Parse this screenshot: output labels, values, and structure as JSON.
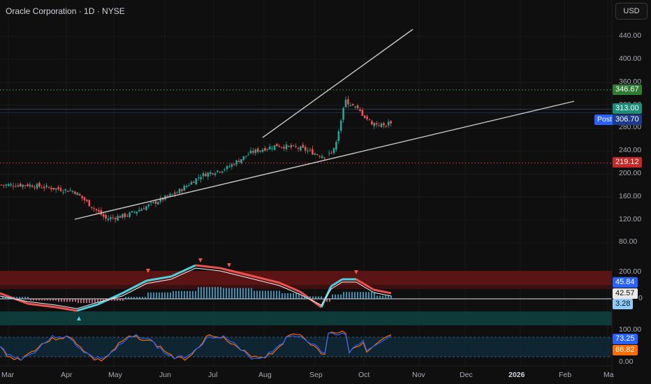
{
  "header": {
    "title": "Oracle Corporation · 1D · NYSE",
    "currency_button": "USD"
  },
  "price_axis": {
    "ticks": [
      "440.00",
      "400.00",
      "360.00",
      "320.00",
      "280.00",
      "240.00",
      "200.00",
      "160.00",
      "120.00",
      "80.00"
    ]
  },
  "price_labels": {
    "resistance": "346.67",
    "last": "313.00",
    "post_tag": "Post",
    "post": "306.70",
    "support": "219.12"
  },
  "oscillator_axis": {
    "top": "200.00",
    "value_a": "45.84",
    "value_b": "42.57",
    "zero": "0",
    "value_c": "3.28"
  },
  "stoch_axis": {
    "top": "100.00",
    "k": "73.25",
    "d": "66.82",
    "bottom": "0.00"
  },
  "time_axis": [
    "Mar",
    "Apr",
    "May",
    "Jun",
    "Jul",
    "Aug",
    "Sep",
    "Oct",
    "Nov",
    "Dec",
    "2026",
    "Feb",
    "Ma"
  ],
  "colors": {
    "up": "#26a69a",
    "down": "#ef5350",
    "resistance": "#4caf50",
    "support": "#f23645",
    "last": "#22ab94",
    "post": "#2962ff",
    "osc_a": "#2962ff",
    "osc_c": "#5b9cf6",
    "stoch_k": "#2962ff",
    "stoch_d": "#ff6d00"
  },
  "chart_data": {
    "type": "candlestick",
    "symbol": "Oracle Corporation · 1D · NYSE",
    "currency": "USD",
    "price_range": [
      60,
      470
    ],
    "months": [
      "Mar",
      "Apr",
      "May",
      "Jun",
      "Jul",
      "Aug",
      "Sep",
      "Oct"
    ],
    "close_path": [
      [
        "Mar",
        181
      ],
      [
        "Apr",
        170
      ],
      [
        "Apr",
        146
      ],
      [
        "Apr",
        122
      ],
      [
        "May",
        128
      ],
      [
        "May",
        148
      ],
      [
        "Jun",
        168
      ],
      [
        "Jun",
        198
      ],
      [
        "Jul",
        210
      ],
      [
        "Jul",
        238
      ],
      [
        "Aug",
        250
      ],
      [
        "Aug",
        244
      ],
      [
        "Sep",
        232
      ],
      [
        "Sep",
        238
      ],
      [
        "Sep",
        328
      ],
      [
        "Sep",
        312
      ],
      [
        "Oct",
        290
      ],
      [
        "Oct",
        284
      ],
      [
        "Oct",
        300
      ],
      [
        "Oct",
        313
      ]
    ],
    "horizontal_levels": [
      {
        "price": 346.67,
        "style": "dotted",
        "color": "#4caf50"
      },
      {
        "price": 219.12,
        "style": "dotted",
        "color": "#f23645"
      },
      {
        "price": 313.0,
        "style": "solid",
        "color": "#2a3a5c"
      }
    ],
    "trendlines": [
      {
        "from": [
          "Apr",
          120
        ],
        "to": [
          "Feb",
          322
        ]
      },
      {
        "from": [
          "Aug",
          262
        ],
        "to": [
          "Nov",
          455
        ]
      }
    ],
    "last_price": 313.0,
    "post_market_price": 306.7,
    "oscillator": {
      "range": [
        -200,
        200
      ],
      "values": [
        45.84,
        42.57,
        3.28
      ]
    },
    "stochastic": {
      "range": [
        0,
        100
      ],
      "k": 73.25,
      "d": 66.82,
      "bands": [
        20,
        80
      ]
    }
  }
}
